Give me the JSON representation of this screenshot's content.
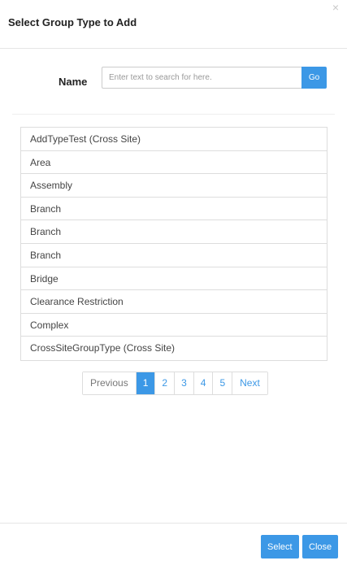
{
  "dialog": {
    "title": "Select Group Type to Add",
    "close_glyph": "×",
    "close_icon": "close-x-icon"
  },
  "search": {
    "label": "Name",
    "placeholder": "Enter text to search for here.",
    "value": "",
    "go_label": "Go"
  },
  "items": [
    "AddTypeTest (Cross Site)",
    "Area",
    "Assembly",
    "Branch",
    "Branch",
    "Branch",
    "Bridge",
    "Clearance Restriction",
    "Complex",
    "CrossSiteGroupType (Cross Site)"
  ],
  "pagination": {
    "previous_label": "Previous",
    "pages": [
      "1",
      "2",
      "3",
      "4",
      "5"
    ],
    "active_page": "1",
    "next_label": "Next"
  },
  "footer": {
    "select_label": "Select",
    "close_label": "Close"
  },
  "colors": {
    "accent": "#3c98e6",
    "border": "#dddddd"
  }
}
